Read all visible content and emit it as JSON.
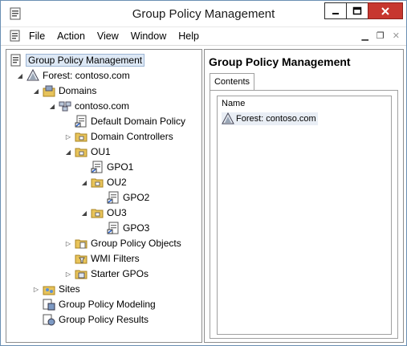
{
  "window": {
    "title": "Group Policy Management"
  },
  "menu": {
    "items": [
      "File",
      "Action",
      "View",
      "Window",
      "Help"
    ]
  },
  "tree": [
    {
      "label": "Group Policy Management",
      "icon": "gpm-icon"
    },
    {
      "label": "Forest: contoso.com",
      "icon": "forest-icon"
    },
    {
      "label": "Domains",
      "icon": "domains-icon"
    },
    {
      "label": "contoso.com",
      "icon": "domain-icon"
    },
    {
      "label": "Default Domain Policy",
      "icon": "gpo-link-icon"
    },
    {
      "label": "Domain Controllers",
      "icon": "ou-folder-icon"
    },
    {
      "label": "OU1",
      "icon": "ou-folder-icon"
    },
    {
      "label": "GPO1",
      "icon": "gpo-link-icon"
    },
    {
      "label": "OU2",
      "icon": "ou-folder-icon"
    },
    {
      "label": "GPO2",
      "icon": "gpo-link-icon"
    },
    {
      "label": "OU3",
      "icon": "ou-folder-icon"
    },
    {
      "label": "GPO3",
      "icon": "gpo-link-icon"
    },
    {
      "label": "Group Policy Objects",
      "icon": "gpo-folder-icon"
    },
    {
      "label": "WMI Filters",
      "icon": "wmi-folder-icon"
    },
    {
      "label": "Starter GPOs",
      "icon": "starter-gpo-folder-icon"
    },
    {
      "label": "Sites",
      "icon": "sites-icon"
    },
    {
      "label": "Group Policy Modeling",
      "icon": "modeling-icon"
    },
    {
      "label": "Group Policy Results",
      "icon": "results-icon"
    }
  ],
  "details": {
    "title": "Group Policy Management",
    "tab": "Contents",
    "column": "Name",
    "rows": [
      "Forest: contoso.com"
    ]
  }
}
